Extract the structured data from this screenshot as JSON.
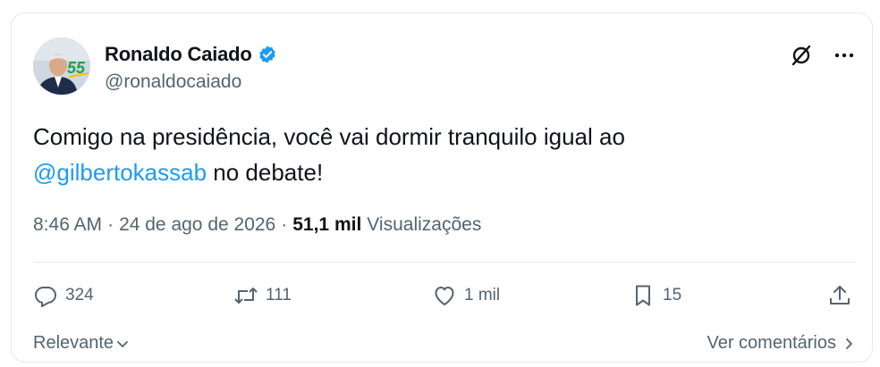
{
  "author": {
    "name": "Ronaldo Caiado",
    "handle": "@ronaldocaiado",
    "avatar_badge": "55"
  },
  "post": {
    "text_before": "Comigo na presidência, você vai dormir tranquilo igual ao ",
    "mention": "@gilbertokassab",
    "text_after": " no debate!"
  },
  "meta": {
    "time": "8:46 AM",
    "separator": "·",
    "date": "24 de ago de 2026",
    "views_count": "51,1 mil",
    "views_label": "Visualizações"
  },
  "actions": {
    "replies": "324",
    "reposts": "111",
    "likes": "1 mil",
    "bookmarks": "15"
  },
  "footer": {
    "sort_label": "Relevante",
    "comments_link": "Ver comentários"
  },
  "colors": {
    "accent": "#1d9bf0",
    "text": "#0f1419",
    "secondary": "#536471",
    "border": "#e7e9ea"
  },
  "icons": [
    "verified-badge-icon",
    "grok-icon",
    "more-icon",
    "reply-icon",
    "repost-icon",
    "like-icon",
    "bookmark-icon",
    "share-icon",
    "chevron-down-icon",
    "chevron-right-icon"
  ]
}
